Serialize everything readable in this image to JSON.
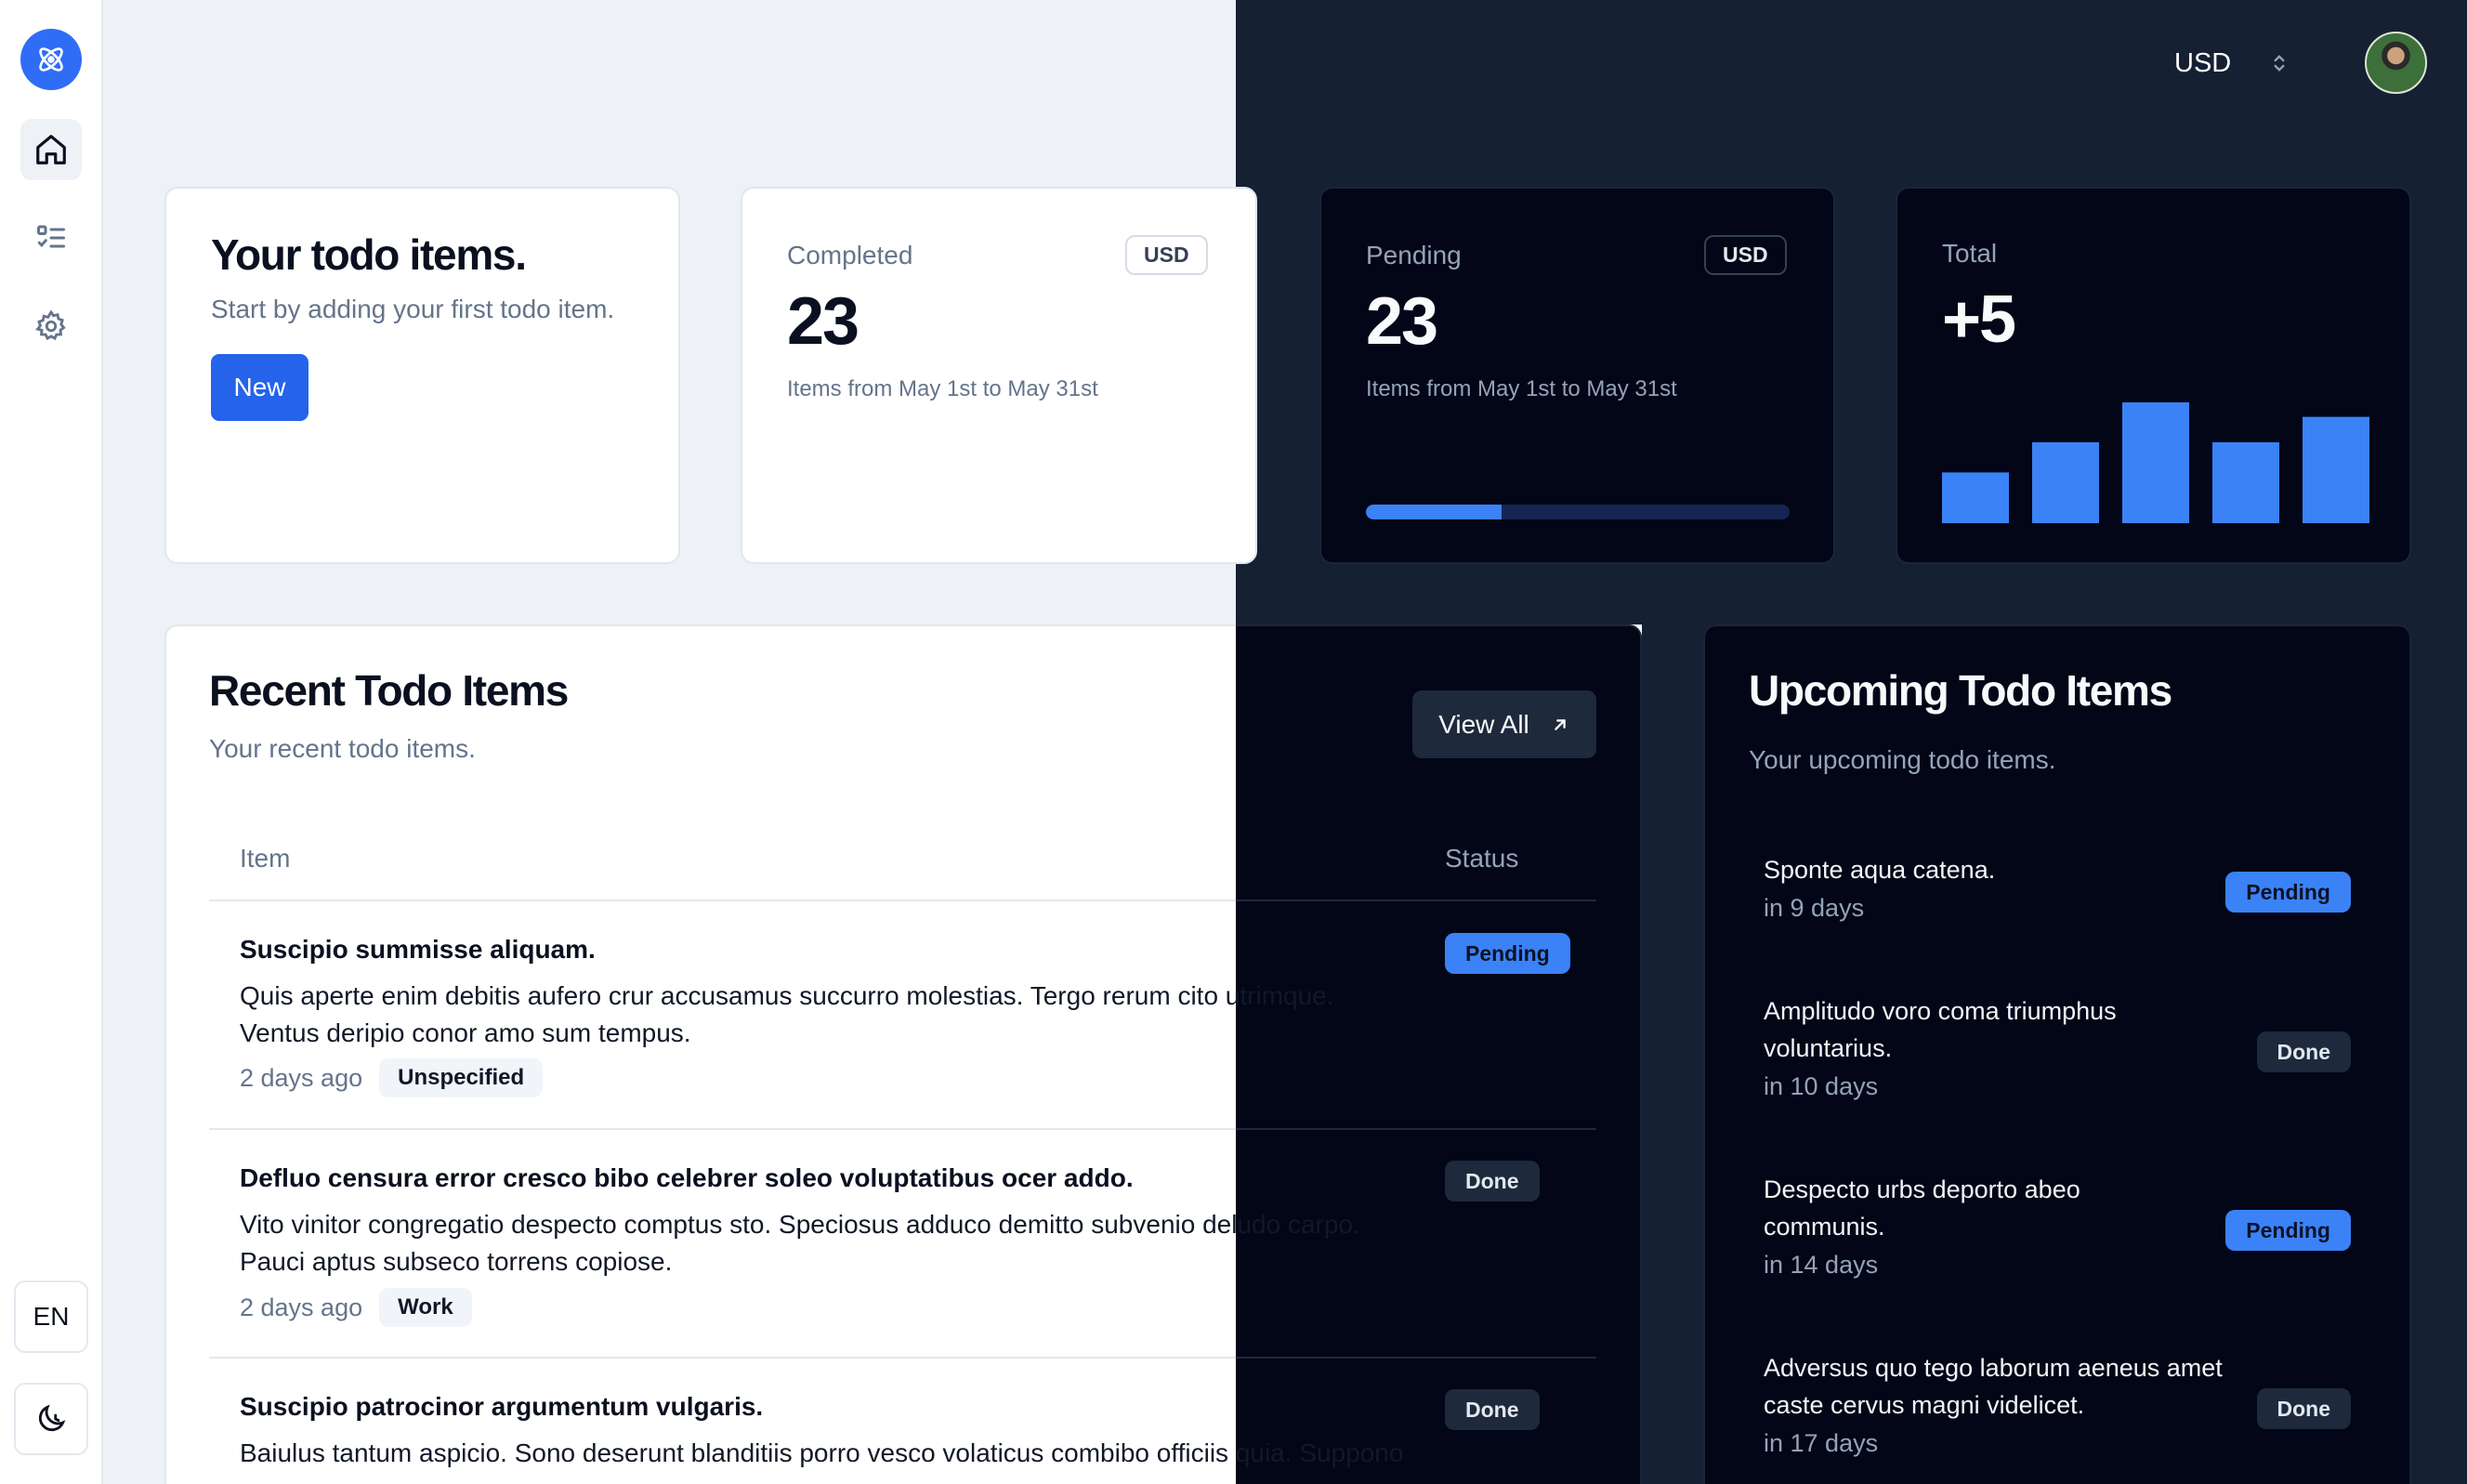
{
  "header": {
    "currency": "USD",
    "avatar_alt": "User avatar"
  },
  "sidebar": {
    "language": "EN"
  },
  "cards": {
    "welcome": {
      "title": "Your todo items.",
      "subtitle": "Start by adding your first todo item.",
      "button": "New"
    },
    "completed": {
      "label": "Completed",
      "badge": "USD",
      "value": "23",
      "caption": "Items from May 1st to May 31st"
    },
    "pending": {
      "label": "Pending",
      "badge": "USD",
      "value": "23",
      "caption": "Items from May 1st to May 31st",
      "progress": 0.32
    },
    "total": {
      "label": "Total",
      "value": "+5"
    }
  },
  "chart_data": {
    "type": "bar",
    "categories": [
      "1",
      "2",
      "3",
      "4",
      "5"
    ],
    "values": [
      42,
      67,
      100,
      67,
      88
    ],
    "ylim": [
      0,
      100
    ],
    "title": "",
    "xlabel": "",
    "ylabel": "",
    "grid": false,
    "color": "#3b82f6"
  },
  "recent": {
    "title": "Recent Todo Items",
    "subtitle": "Your recent todo items.",
    "view_all": "View All",
    "columns": {
      "item": "Item",
      "status": "Status"
    },
    "rows": [
      {
        "title": "Suscipio summisse aliquam.",
        "desc1": "Quis aperte enim debitis aufero crur accusamus succurro molestias. Tergo rerum cito utrimque.",
        "desc2": "Ventus deripio conor amo sum tempus.",
        "when": "2 days ago",
        "tag": "Unspecified",
        "status": "Pending"
      },
      {
        "title": "Defluo censura error cresco bibo celebrer soleo voluptatibus ocer addo.",
        "desc1": "Vito vinitor congregatio despecto comptus sto. Speciosus adduco demitto subvenio deludo carpo.",
        "desc2": "Pauci aptus subseco torrens copiose.",
        "when": "2 days ago",
        "tag": "Work",
        "status": "Done"
      },
      {
        "title": "Suscipio patrocinor argumentum vulgaris.",
        "desc1": "Baiulus tantum aspicio. Sono deserunt blanditiis porro vesco volaticus combibo officiis quia. Suppono",
        "status": "Done"
      }
    ]
  },
  "upcoming": {
    "title": "Upcoming Todo Items",
    "subtitle": "Your upcoming todo items.",
    "items": [
      {
        "line1": "Sponte aqua catena.",
        "line2": "",
        "when": "in 9 days",
        "status": "Pending"
      },
      {
        "line1": "Amplitudo voro coma triumphus",
        "line2": "voluntarius.",
        "when": "in 10 days",
        "status": "Done"
      },
      {
        "line1": "Despecto urbs deporto abeo",
        "line2": "communis.",
        "when": "in 14 days",
        "status": "Pending"
      },
      {
        "line1": "Adversus quo tego laborum aeneus amet",
        "line2": "caste cervus magni videlicet.",
        "when": "in 17 days",
        "status": "Done"
      }
    ]
  }
}
